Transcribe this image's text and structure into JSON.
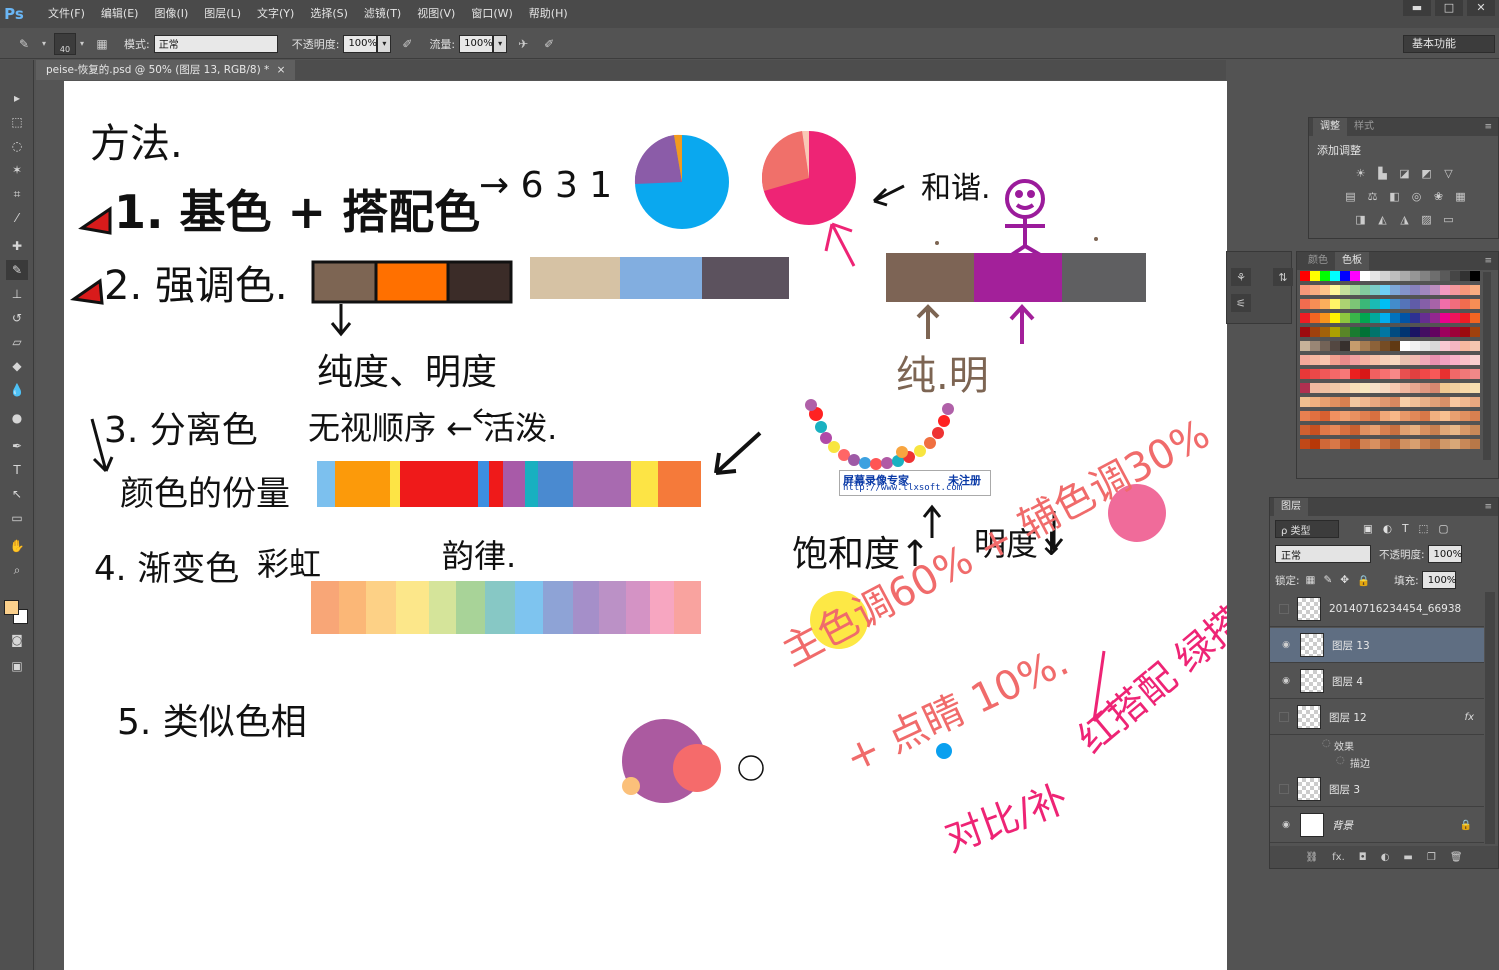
{
  "app": {
    "logo": "Ps",
    "menu": [
      "文件(F)",
      "编辑(E)",
      "图像(I)",
      "图层(L)",
      "文字(Y)",
      "选择(S)",
      "滤镜(T)",
      "视图(V)",
      "窗口(W)",
      "帮助(H)"
    ],
    "window_controls": [
      "▬",
      "□",
      "✕"
    ]
  },
  "options": {
    "brush_size": "40",
    "mode_label": "模式:",
    "mode_value": "正常",
    "opacity_label": "不透明度:",
    "opacity_value": "100%",
    "flow_label": "流量:",
    "flow_value": "100%",
    "workspace": "基本功能"
  },
  "document": {
    "tab_title": "peise-恢复的.psd @ 50% (图层 13, RGB/8) *",
    "tab_close": "×"
  },
  "canvas_text": {
    "method": "方法.",
    "item1": "1. 基色 + 搭配色",
    "arrow631": "→ 6 3 1",
    "harmony": "和谐.",
    "item2": "2. 强调色.",
    "sat_bright": "纯度、明度",
    "pure_bright": "纯.明",
    "item3": "3. 分离色",
    "no_order": "无视顺序 ← 活泼.",
    "weight": "颜色的份量",
    "saturation": "饱和度↑",
    "brightness": "明度↓",
    "item4": "4. 渐变色",
    "rainbow": "彩虹",
    "rhythm": "韵律.",
    "item5": "5. 类似色相",
    "main_tone": "主色调60% + 辅色调30%",
    "highlight": "+ 点睛 10%.",
    "contrast": "对比/补",
    "red_green": "红搭配 绿搭配",
    "watermark_cn": "屏幕录像专家",
    "watermark_reg": "未注册",
    "watermark_url": "http://www.tlxsoft.com"
  },
  "panels": {
    "adjust_tabs": [
      "调整",
      "样式"
    ],
    "adjust_title": "添加调整",
    "color_tabs": [
      "颜色",
      "色板"
    ],
    "layers_tab": "图层",
    "kind_label": "ρ 类型",
    "blend_mode": "正常",
    "opacity_label": "不透明度:",
    "opacity_value": "100%",
    "lock_label": "锁定:",
    "fill_label": "填充:",
    "fill_value": "100%",
    "layers": [
      {
        "name": "20140716234454_66938",
        "visible": false,
        "selected": false
      },
      {
        "name": "图层 13",
        "visible": true,
        "selected": true
      },
      {
        "name": "图层 4",
        "visible": true,
        "selected": false
      },
      {
        "name": "图层 12",
        "visible": false,
        "selected": false,
        "fx": "fx"
      },
      {
        "name": "图层 3",
        "visible": false,
        "selected": false
      },
      {
        "name": "背景",
        "visible": true,
        "selected": false,
        "locked": true
      }
    ],
    "effects_label": "效果",
    "stroke_label": "描边"
  },
  "colors": {
    "foreground": "#fbd08c",
    "background": "#ffffff",
    "accent_blue": "#5f6e82"
  }
}
